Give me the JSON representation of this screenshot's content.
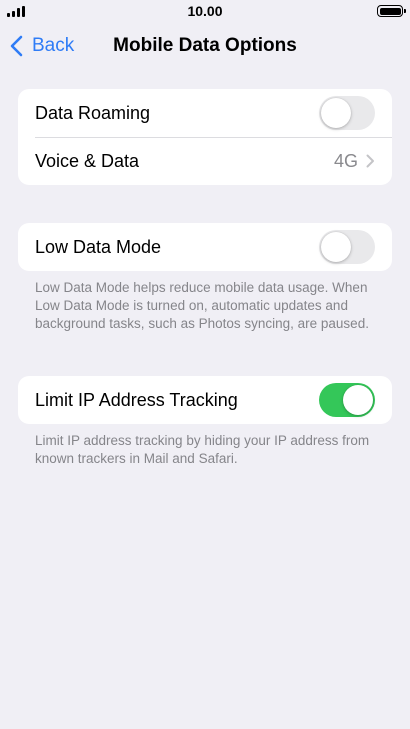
{
  "status_bar": {
    "time": "10.00"
  },
  "nav": {
    "back_label": "Back",
    "title": "Mobile Data Options"
  },
  "groups": [
    {
      "rows": [
        {
          "label": "Data Roaming",
          "toggle_on": false
        },
        {
          "label": "Voice & Data",
          "value": "4G"
        }
      ]
    },
    {
      "rows": [
        {
          "label": "Low Data Mode",
          "toggle_on": false
        }
      ],
      "footer": "Low Data Mode helps reduce mobile data usage. When Low Data Mode is turned on, automatic updates and background tasks, such as Photos syncing, are paused."
    },
    {
      "rows": [
        {
          "label": "Limit IP Address Tracking",
          "toggle_on": true
        }
      ],
      "footer": "Limit IP address tracking by hiding your IP address from known trackers in Mail and Safari."
    }
  ],
  "colors": {
    "accent": "#2f7cf6",
    "toggle_on": "#34c759",
    "toggle_off": "#e9e9eb",
    "background": "#f0eff5"
  },
  "icons": [
    "signal-icon",
    "battery-icon",
    "back-chevron-icon",
    "chevron-right-icon"
  ]
}
